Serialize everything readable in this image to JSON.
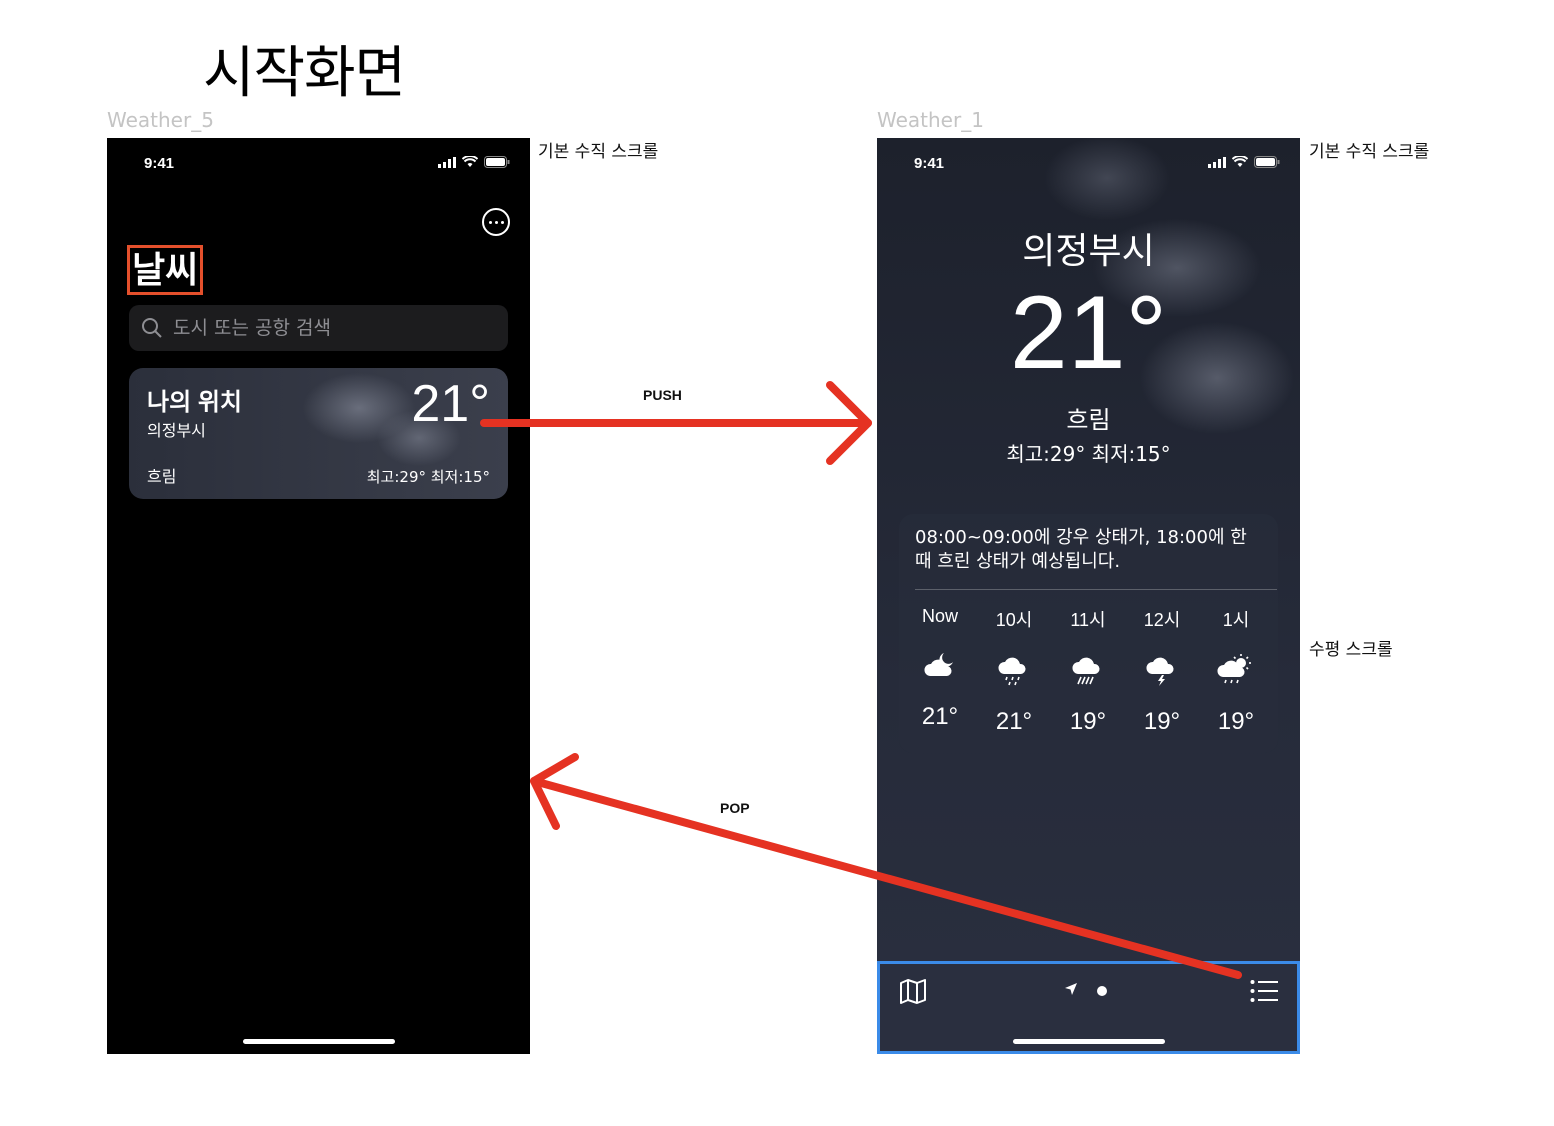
{
  "page_title": "시작화면",
  "frames": {
    "list": {
      "label": "Weather_5",
      "annotation": "기본 수직 스크롤",
      "status_time": "9:41",
      "title": "날씨",
      "search_placeholder": "도시 또는 공항 검색",
      "card": {
        "title": "나의 위치",
        "city": "의정부시",
        "temp": "21°",
        "condition": "흐림",
        "hi_lo": "최고:29° 최저:15°"
      }
    },
    "detail": {
      "label": "Weather_1",
      "annotation": "기본 수직 스크롤",
      "scroll_annotation": "수평 스크롤",
      "status_time": "9:41",
      "city": "의정부시",
      "temp": "21°",
      "condition": "흐림",
      "hi_lo": "최고:29° 최저:15°",
      "summary": "08:00~09:00에 강우 상태가, 18:00에 한 때 흐린 상태가 예상됩니다.",
      "hourly": [
        {
          "label": "Now",
          "icon": "cloud-moon-icon",
          "temp": "21°"
        },
        {
          "label": "10시",
          "icon": "cloud-drizzle-icon",
          "temp": "21°"
        },
        {
          "label": "11시",
          "icon": "cloud-heavy-rain-icon",
          "temp": "19°"
        },
        {
          "label": "12시",
          "icon": "cloud-bolt-icon",
          "temp": "19°"
        },
        {
          "label": "1시",
          "icon": "cloud-sun-rain-icon",
          "temp": "19°"
        }
      ]
    }
  },
  "transitions": {
    "push": "PUSH",
    "pop": "POP"
  },
  "colors": {
    "arrow": "#e53222",
    "title_highlight": "#e4502c",
    "toolbar_highlight": "#3b8be8"
  }
}
